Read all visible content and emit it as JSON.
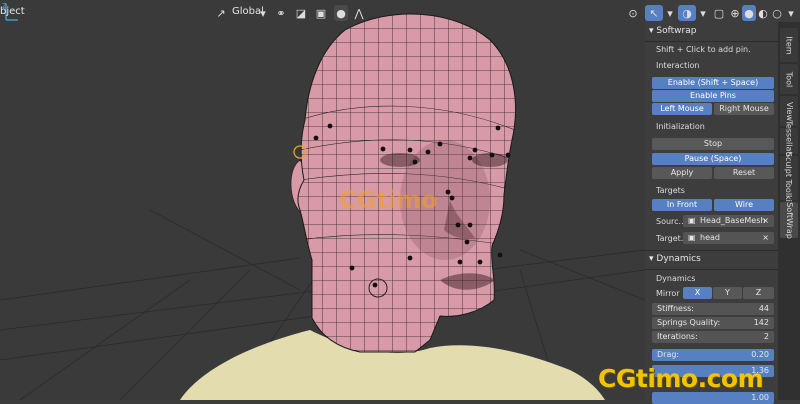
{
  "header": {
    "mode_label": "bject",
    "orientation": "Global"
  },
  "viewport_watermark": "CGtimo",
  "panel": {
    "title": "Softwrap",
    "hint": "Shift + Click to add pin.",
    "interaction": {
      "label": "Interaction",
      "enable_button": "Enable (Shift + Space)",
      "enable_pins": "Enable Pins",
      "left_mouse": "Left Mouse",
      "right_mouse": "Right Mouse"
    },
    "initialization": {
      "label": "Initialization",
      "stop": "Stop",
      "pause": "Pause (Space)",
      "apply": "Apply",
      "reset": "Reset"
    },
    "targets": {
      "label": "Targets",
      "in_front": "In Front",
      "wire": "Wire",
      "source_label": "Sourc...",
      "source_value": "Head_BaseMesh",
      "target_label": "Target...",
      "target_value": "head"
    },
    "dynamics_section": "Dynamics",
    "dynamics": {
      "label": "Dynamics",
      "mirror_label": "Mirror",
      "mirror_x": "X",
      "mirror_y": "Y",
      "mirror_z": "Z",
      "stiffness_label": "Stiffness:",
      "stiffness_value": "44",
      "springs_label": "Springs Quality:",
      "springs_value": "142",
      "iterations_label": "Iterations:",
      "iterations_value": "2",
      "drag_label": "Drag:",
      "drag_value": "0.20",
      "smooth_value": "1.36",
      "last_value": "1.00"
    }
  },
  "tabs": [
    "Item",
    "Tool",
    "View",
    "Tessellator",
    "Sculpt Toolkit",
    "SoftWrap"
  ],
  "watermark": "CGtimo.com",
  "colors": {
    "accent": "#5680c2",
    "mesh_skin": "#d99aa8",
    "wire": "#222222",
    "body": "#e3dcae",
    "watermark": "#f2c400"
  }
}
